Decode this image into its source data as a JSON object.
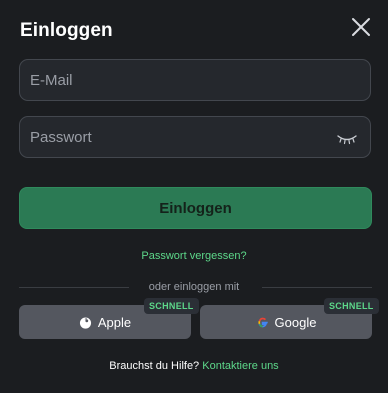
{
  "header": {
    "title": "Einloggen"
  },
  "form": {
    "email": {
      "placeholder": "E-Mail",
      "value": ""
    },
    "password": {
      "placeholder": "Passwort",
      "value": ""
    },
    "submit_label": "Einloggen",
    "forgot_label": "Passwort vergessen?"
  },
  "social": {
    "divider_label": "oder einloggen mit",
    "apple": {
      "label": "Apple",
      "badge": "SCHNELL",
      "icon": "apple-icon"
    },
    "google": {
      "label": "Google",
      "badge": "SCHNELL",
      "icon": "google-icon"
    }
  },
  "help": {
    "prompt": "Brauchst du Hilfe?",
    "link": "Kontaktiere uns"
  },
  "colors": {
    "background": "#1b1d20",
    "field_bg": "#25282d",
    "primary_button": "#2b7a54",
    "accent_green": "#5dd88a",
    "social_button": "#54575f"
  },
  "icons": {
    "close": "close-icon",
    "password_toggle": "eye-closed-icon"
  }
}
